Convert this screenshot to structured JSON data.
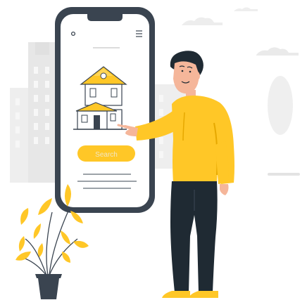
{
  "illustration": {
    "button_label": "Search",
    "colors": {
      "accent": "#FFC727",
      "accent_dark": "#E6A800",
      "phone_frame": "#3A4450",
      "phone_screen": "#FFFFFF",
      "building": "#E7E7E7",
      "building_window": "#F7F7F7",
      "cloud": "#EBEBEB",
      "skin": "#F5B69A",
      "hair": "#1F2A33",
      "pants": "#1F2A33",
      "pot": "#3A4450",
      "house_outline": "#3A4450"
    },
    "icons": [
      "phone-icon",
      "house-icon",
      "person-icon",
      "plant-icon",
      "city-background-icon"
    ]
  }
}
